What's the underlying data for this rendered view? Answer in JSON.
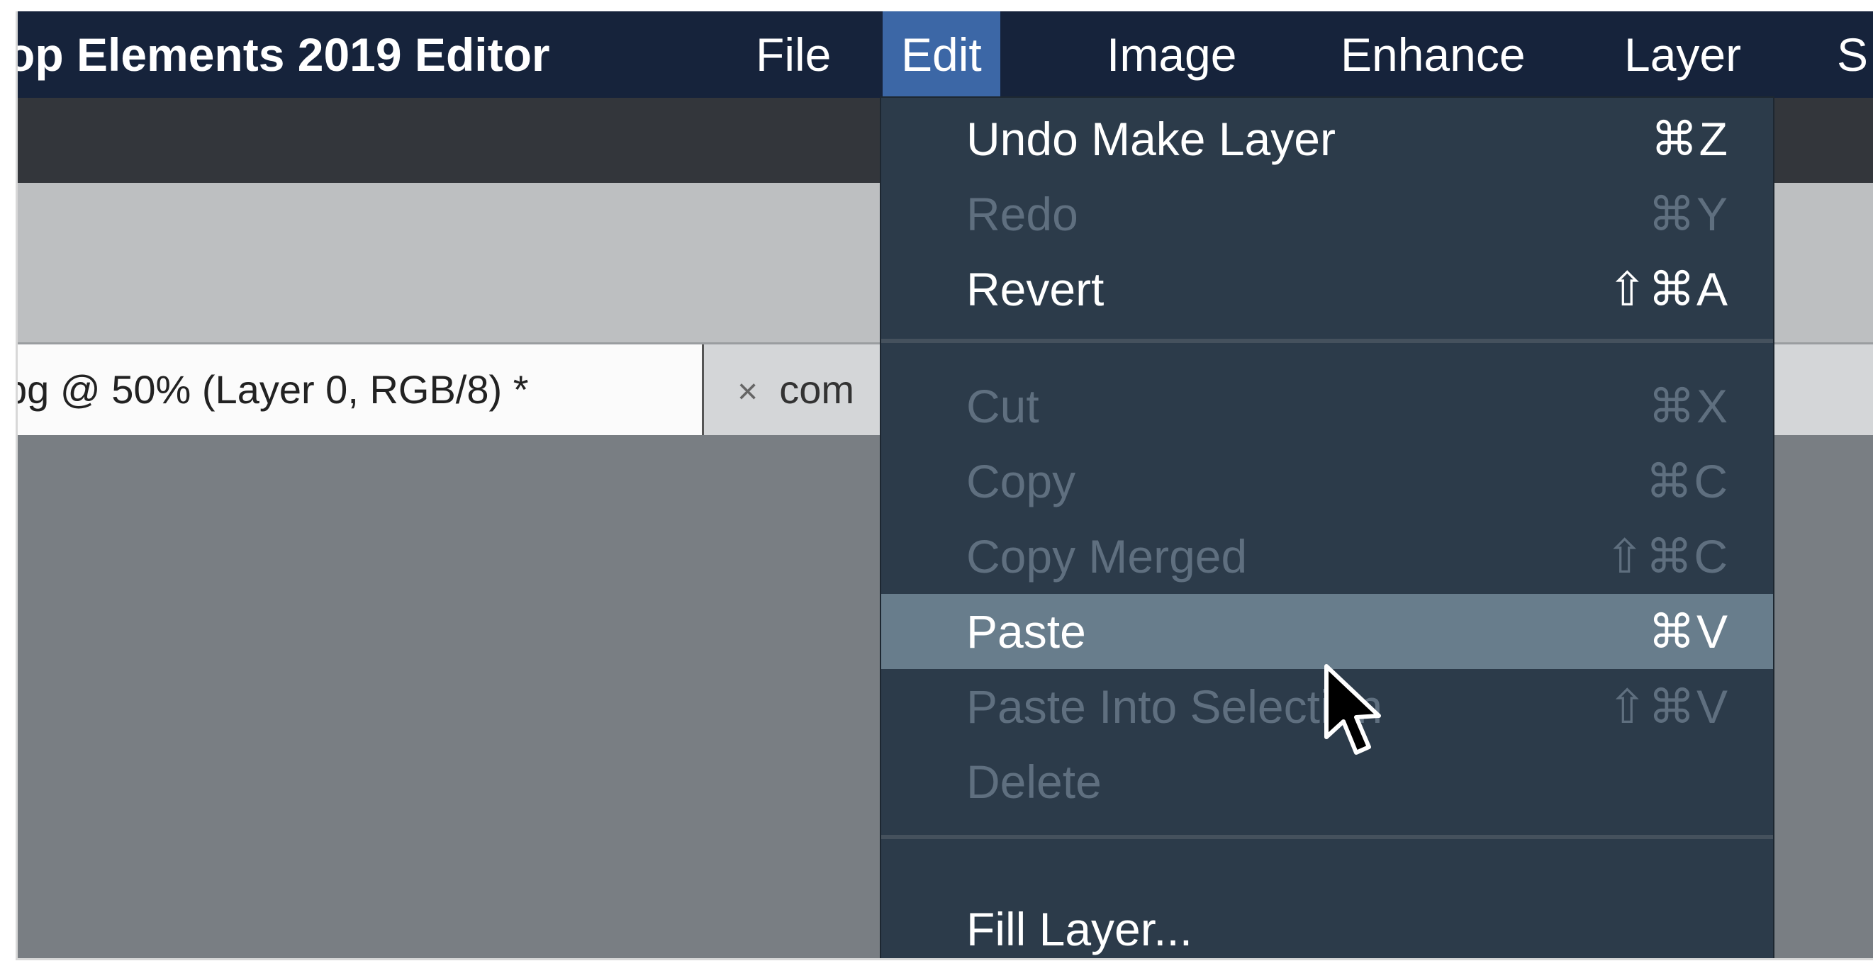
{
  "app": {
    "title": "op Elements 2019 Editor"
  },
  "menubar": {
    "items": [
      {
        "label": "File"
      },
      {
        "label": "Edit"
      },
      {
        "label": "Image"
      },
      {
        "label": "Enhance"
      },
      {
        "label": "Layer"
      },
      {
        "label": "S"
      }
    ],
    "active": "Edit"
  },
  "tabs": {
    "active_tab": "pg @ 50% (Layer 0, RGB/8) *",
    "second_tab_close": "×",
    "second_tab": "com"
  },
  "edit_menu": {
    "items": [
      {
        "label": "Undo Make Layer",
        "shortcut": "⌘Z",
        "enabled": true
      },
      {
        "label": "Redo",
        "shortcut": "⌘Y",
        "enabled": false
      },
      {
        "label": "Revert",
        "shortcut": "⇧⌘A",
        "enabled": true
      },
      {
        "label": "Cut",
        "shortcut": "⌘X",
        "enabled": false
      },
      {
        "label": "Copy",
        "shortcut": "⌘C",
        "enabled": false
      },
      {
        "label": "Copy Merged",
        "shortcut": "⇧⌘C",
        "enabled": false
      },
      {
        "label": "Paste",
        "shortcut": "⌘V",
        "enabled": true,
        "highlighted": true
      },
      {
        "label": "Paste Into Selection",
        "shortcut": "⇧⌘V",
        "enabled": false
      },
      {
        "label": "Delete",
        "shortcut": "",
        "enabled": false
      },
      {
        "label": "Fill Layer...",
        "shortcut": "",
        "enabled": true
      }
    ]
  },
  "colors": {
    "menubar_bg": "#16233b",
    "menu_active_bg": "#3c67a6",
    "dropdown_bg": "#2c3b4a",
    "highlight_bg": "#687d8c",
    "disabled_text": "#5f6f7f"
  }
}
